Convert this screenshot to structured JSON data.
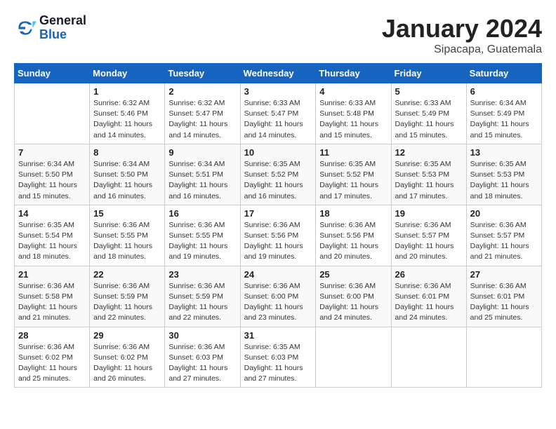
{
  "logo": {
    "line1": "General",
    "line2": "Blue"
  },
  "title": "January 2024",
  "subtitle": "Sipacapa, Guatemala",
  "weekdays": [
    "Sunday",
    "Monday",
    "Tuesday",
    "Wednesday",
    "Thursday",
    "Friday",
    "Saturday"
  ],
  "weeks": [
    [
      {
        "day": "",
        "sunrise": "",
        "sunset": "",
        "daylight": ""
      },
      {
        "day": "1",
        "sunrise": "Sunrise: 6:32 AM",
        "sunset": "Sunset: 5:46 PM",
        "daylight": "Daylight: 11 hours and 14 minutes."
      },
      {
        "day": "2",
        "sunrise": "Sunrise: 6:32 AM",
        "sunset": "Sunset: 5:47 PM",
        "daylight": "Daylight: 11 hours and 14 minutes."
      },
      {
        "day": "3",
        "sunrise": "Sunrise: 6:33 AM",
        "sunset": "Sunset: 5:47 PM",
        "daylight": "Daylight: 11 hours and 14 minutes."
      },
      {
        "day": "4",
        "sunrise": "Sunrise: 6:33 AM",
        "sunset": "Sunset: 5:48 PM",
        "daylight": "Daylight: 11 hours and 15 minutes."
      },
      {
        "day": "5",
        "sunrise": "Sunrise: 6:33 AM",
        "sunset": "Sunset: 5:49 PM",
        "daylight": "Daylight: 11 hours and 15 minutes."
      },
      {
        "day": "6",
        "sunrise": "Sunrise: 6:34 AM",
        "sunset": "Sunset: 5:49 PM",
        "daylight": "Daylight: 11 hours and 15 minutes."
      }
    ],
    [
      {
        "day": "7",
        "sunrise": "Sunrise: 6:34 AM",
        "sunset": "Sunset: 5:50 PM",
        "daylight": "Daylight: 11 hours and 15 minutes."
      },
      {
        "day": "8",
        "sunrise": "Sunrise: 6:34 AM",
        "sunset": "Sunset: 5:50 PM",
        "daylight": "Daylight: 11 hours and 16 minutes."
      },
      {
        "day": "9",
        "sunrise": "Sunrise: 6:34 AM",
        "sunset": "Sunset: 5:51 PM",
        "daylight": "Daylight: 11 hours and 16 minutes."
      },
      {
        "day": "10",
        "sunrise": "Sunrise: 6:35 AM",
        "sunset": "Sunset: 5:52 PM",
        "daylight": "Daylight: 11 hours and 16 minutes."
      },
      {
        "day": "11",
        "sunrise": "Sunrise: 6:35 AM",
        "sunset": "Sunset: 5:52 PM",
        "daylight": "Daylight: 11 hours and 17 minutes."
      },
      {
        "day": "12",
        "sunrise": "Sunrise: 6:35 AM",
        "sunset": "Sunset: 5:53 PM",
        "daylight": "Daylight: 11 hours and 17 minutes."
      },
      {
        "day": "13",
        "sunrise": "Sunrise: 6:35 AM",
        "sunset": "Sunset: 5:53 PM",
        "daylight": "Daylight: 11 hours and 18 minutes."
      }
    ],
    [
      {
        "day": "14",
        "sunrise": "Sunrise: 6:35 AM",
        "sunset": "Sunset: 5:54 PM",
        "daylight": "Daylight: 11 hours and 18 minutes."
      },
      {
        "day": "15",
        "sunrise": "Sunrise: 6:36 AM",
        "sunset": "Sunset: 5:55 PM",
        "daylight": "Daylight: 11 hours and 18 minutes."
      },
      {
        "day": "16",
        "sunrise": "Sunrise: 6:36 AM",
        "sunset": "Sunset: 5:55 PM",
        "daylight": "Daylight: 11 hours and 19 minutes."
      },
      {
        "day": "17",
        "sunrise": "Sunrise: 6:36 AM",
        "sunset": "Sunset: 5:56 PM",
        "daylight": "Daylight: 11 hours and 19 minutes."
      },
      {
        "day": "18",
        "sunrise": "Sunrise: 6:36 AM",
        "sunset": "Sunset: 5:56 PM",
        "daylight": "Daylight: 11 hours and 20 minutes."
      },
      {
        "day": "19",
        "sunrise": "Sunrise: 6:36 AM",
        "sunset": "Sunset: 5:57 PM",
        "daylight": "Daylight: 11 hours and 20 minutes."
      },
      {
        "day": "20",
        "sunrise": "Sunrise: 6:36 AM",
        "sunset": "Sunset: 5:57 PM",
        "daylight": "Daylight: 11 hours and 21 minutes."
      }
    ],
    [
      {
        "day": "21",
        "sunrise": "Sunrise: 6:36 AM",
        "sunset": "Sunset: 5:58 PM",
        "daylight": "Daylight: 11 hours and 21 minutes."
      },
      {
        "day": "22",
        "sunrise": "Sunrise: 6:36 AM",
        "sunset": "Sunset: 5:59 PM",
        "daylight": "Daylight: 11 hours and 22 minutes."
      },
      {
        "day": "23",
        "sunrise": "Sunrise: 6:36 AM",
        "sunset": "Sunset: 5:59 PM",
        "daylight": "Daylight: 11 hours and 22 minutes."
      },
      {
        "day": "24",
        "sunrise": "Sunrise: 6:36 AM",
        "sunset": "Sunset: 6:00 PM",
        "daylight": "Daylight: 11 hours and 23 minutes."
      },
      {
        "day": "25",
        "sunrise": "Sunrise: 6:36 AM",
        "sunset": "Sunset: 6:00 PM",
        "daylight": "Daylight: 11 hours and 24 minutes."
      },
      {
        "day": "26",
        "sunrise": "Sunrise: 6:36 AM",
        "sunset": "Sunset: 6:01 PM",
        "daylight": "Daylight: 11 hours and 24 minutes."
      },
      {
        "day": "27",
        "sunrise": "Sunrise: 6:36 AM",
        "sunset": "Sunset: 6:01 PM",
        "daylight": "Daylight: 11 hours and 25 minutes."
      }
    ],
    [
      {
        "day": "28",
        "sunrise": "Sunrise: 6:36 AM",
        "sunset": "Sunset: 6:02 PM",
        "daylight": "Daylight: 11 hours and 25 minutes."
      },
      {
        "day": "29",
        "sunrise": "Sunrise: 6:36 AM",
        "sunset": "Sunset: 6:02 PM",
        "daylight": "Daylight: 11 hours and 26 minutes."
      },
      {
        "day": "30",
        "sunrise": "Sunrise: 6:36 AM",
        "sunset": "Sunset: 6:03 PM",
        "daylight": "Daylight: 11 hours and 27 minutes."
      },
      {
        "day": "31",
        "sunrise": "Sunrise: 6:35 AM",
        "sunset": "Sunset: 6:03 PM",
        "daylight": "Daylight: 11 hours and 27 minutes."
      },
      {
        "day": "",
        "sunrise": "",
        "sunset": "",
        "daylight": ""
      },
      {
        "day": "",
        "sunrise": "",
        "sunset": "",
        "daylight": ""
      },
      {
        "day": "",
        "sunrise": "",
        "sunset": "",
        "daylight": ""
      }
    ]
  ]
}
